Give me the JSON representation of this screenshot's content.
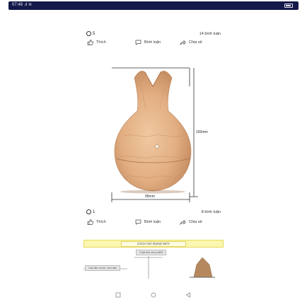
{
  "status": {
    "time": "07:48 .ıl ≋"
  },
  "posts": [
    {
      "number": "5",
      "comment_count": "14 bình luận",
      "actions": {
        "like": "Thích",
        "comment": "Bình luận",
        "share": "Chia sẻ"
      }
    },
    {
      "number": "1",
      "comment_count": "8 bình luận",
      "actions": {
        "like": "Thích",
        "comment": "Bình luận",
        "share": "Chia sẻ"
      }
    }
  ],
  "product": {
    "height_label": "150mm",
    "width_label": "95mm"
  },
  "banner": {
    "title": "CÁCH SỬ DỤNG MÁY"
  },
  "instructions": {
    "left_label": "Các đèn nước- tinh dầu",
    "center_label": "Chất liệu nhựa ABS"
  },
  "colors": {
    "status_bar": "#14194a",
    "wood_light": "#e7b98f",
    "wood_dark": "#c9916a",
    "banner_bg": "#fbf6b0"
  },
  "icons": {
    "like": "thumbs-up-icon",
    "comment": "comment-bubble-icon",
    "share": "share-arrow-icon",
    "nav_back": "triangle-back-icon",
    "nav_home": "circle-home-icon",
    "nav_recent": "square-recent-icon"
  }
}
